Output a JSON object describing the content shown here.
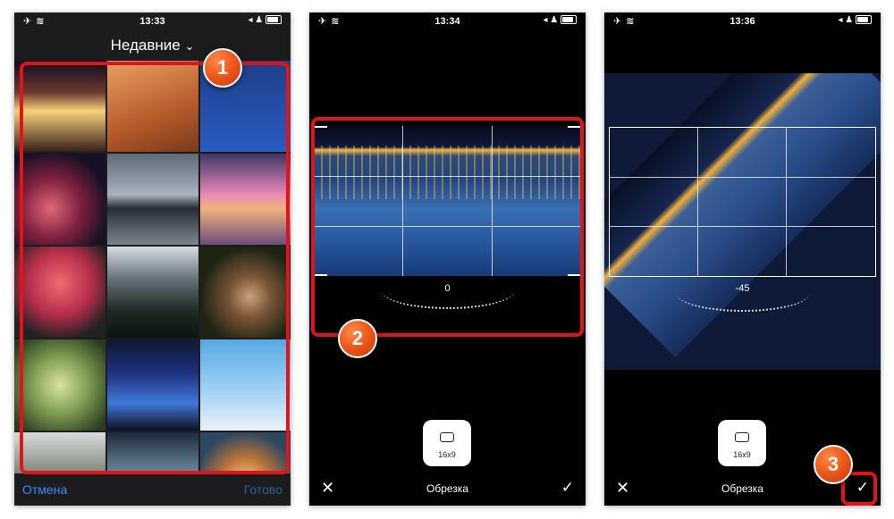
{
  "screens": [
    {
      "status": {
        "time": "13:33",
        "left_icons": "✈ ≋",
        "right_icons": "◂ ♟"
      },
      "title": "Недавние",
      "chevron": "⌄",
      "cancel_label": "Отмена",
      "done_label": "Готово"
    },
    {
      "status": {
        "time": "13:34",
        "left_icons": "✈ ≋",
        "right_icons": "◂ ♟"
      },
      "angle": "0",
      "ratio_label": "16x9",
      "close_glyph": "✕",
      "mode_label": "Обрезка",
      "confirm_glyph": "✓"
    },
    {
      "status": {
        "time": "13:36",
        "left_icons": "✈ ≋",
        "right_icons": "◂ ♟"
      },
      "angle": "-45",
      "ratio_label": "16x9",
      "close_glyph": "✕",
      "mode_label": "Обрезка",
      "confirm_glyph": "✓"
    }
  ],
  "annotations": [
    "1",
    "2",
    "3"
  ],
  "accent_color": "#e0141b"
}
